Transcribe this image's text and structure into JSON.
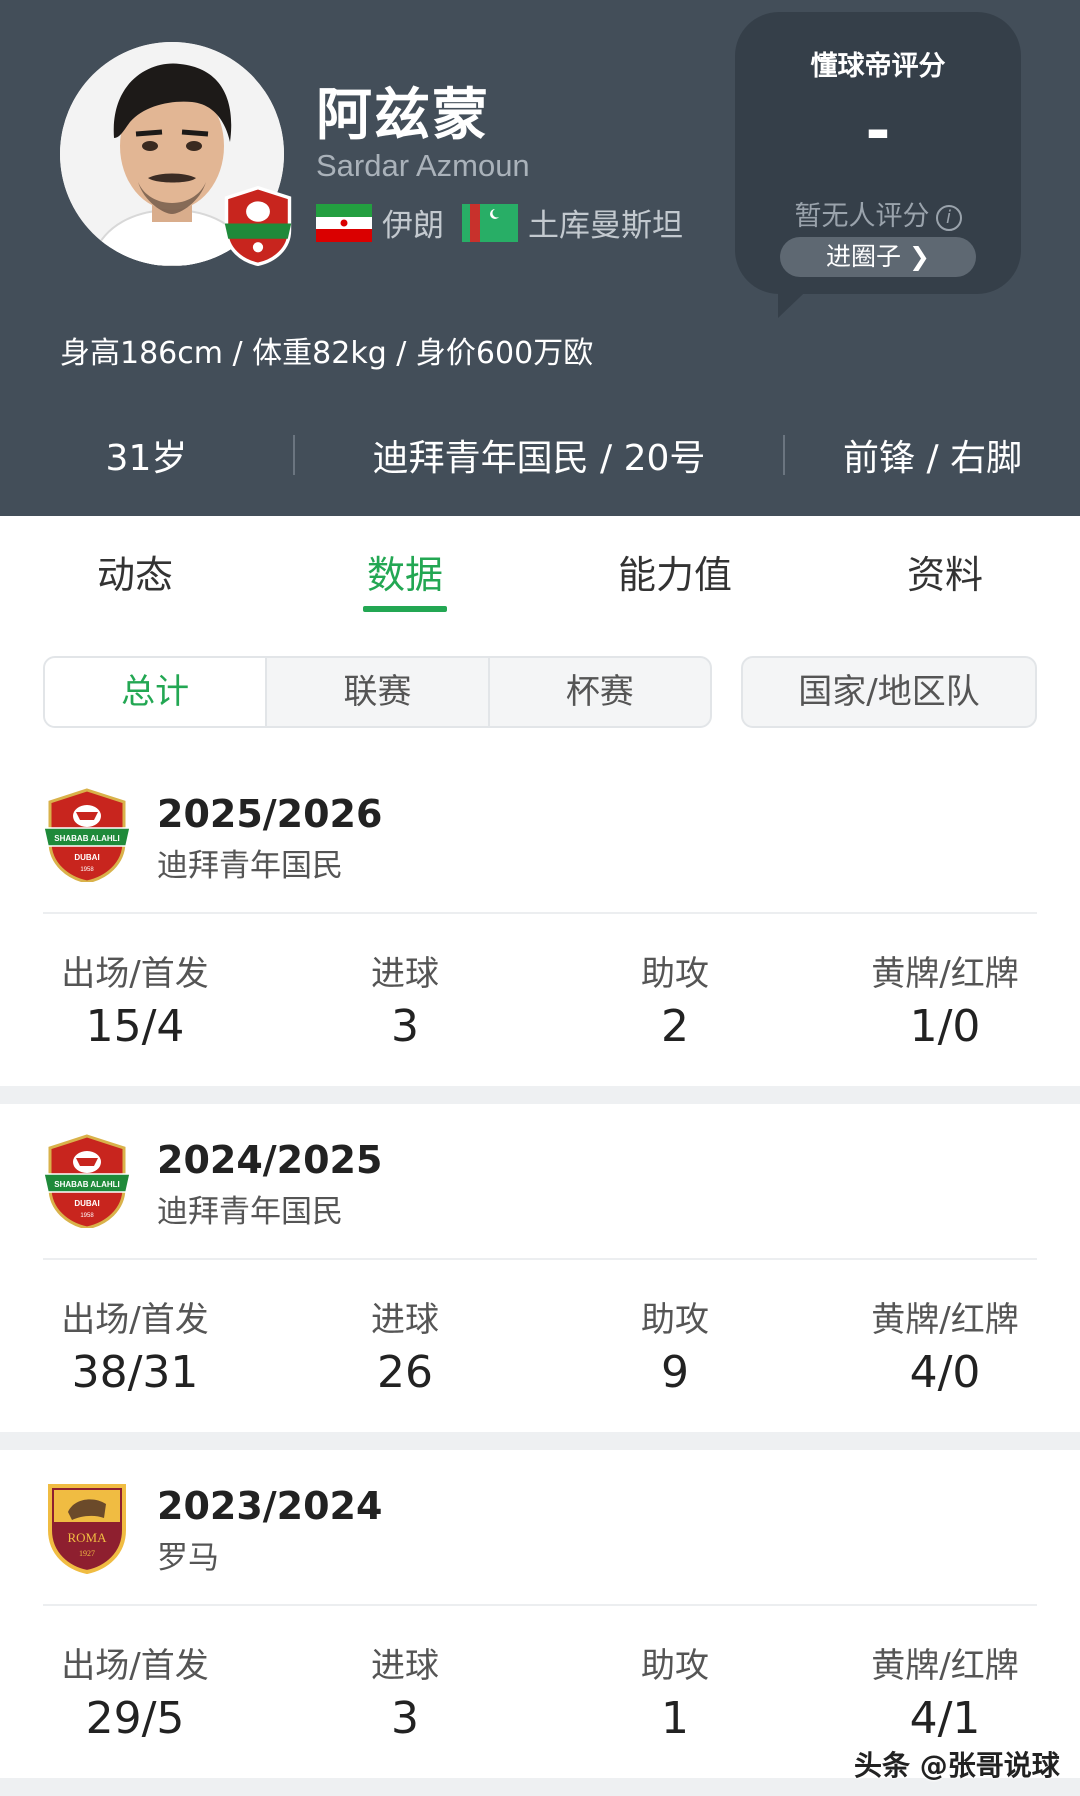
{
  "player": {
    "name_cn": "阿兹蒙",
    "name_en": "Sardar Azmoun",
    "nationalities": [
      {
        "name": "伊朗",
        "flag": "iran-flag-icon"
      },
      {
        "name": "土库曼斯坦",
        "flag": "turkmenistan-flag-icon"
      }
    ],
    "body_info": "身高186cm / 体重82kg / 身价600万欧",
    "age": "31岁",
    "club_number": "迪拜青年国民 / 20号",
    "position_foot": "前锋 / 右脚"
  },
  "rating": {
    "title": "懂球帝评分",
    "value": "-",
    "note": "暂无人评分",
    "button": "进圈子 ❯"
  },
  "tabs": [
    {
      "label": "动态",
      "active": false
    },
    {
      "label": "数据",
      "active": true
    },
    {
      "label": "能力值",
      "active": false
    },
    {
      "label": "资料",
      "active": false
    }
  ],
  "filters": {
    "segments": [
      "总计",
      "联赛",
      "杯赛"
    ],
    "selected": "总计",
    "national": "国家/地区队"
  },
  "stat_labels": {
    "apps": "出场/首发",
    "goals": "进球",
    "assists": "助攻",
    "cards": "黄牌/红牌"
  },
  "seasons": [
    {
      "year": "2025/2026",
      "club": "迪拜青年国民",
      "logo": "shabab-alahli-logo-icon",
      "apps": "15/4",
      "goals": "3",
      "assists": "2",
      "cards": "1/0"
    },
    {
      "year": "2024/2025",
      "club": "迪拜青年国民",
      "logo": "shabab-alahli-logo-icon",
      "apps": "38/31",
      "goals": "26",
      "assists": "9",
      "cards": "4/0"
    },
    {
      "year": "2023/2024",
      "club": "罗马",
      "logo": "as-roma-logo-icon",
      "apps": "29/5",
      "goals": "3",
      "assists": "1",
      "cards": "4/1"
    }
  ],
  "badge_text": {
    "shabab_top": "SHABAB ALAHLI",
    "shabab_city": "DUBAI",
    "shabab_year": "1958",
    "roma_name": "ROMA",
    "roma_year": "1927"
  },
  "watermark": "头条 @张哥说球",
  "colors": {
    "header_bg": "#434e59",
    "accent_green": "#23a753",
    "rating_box": "#353f49"
  }
}
